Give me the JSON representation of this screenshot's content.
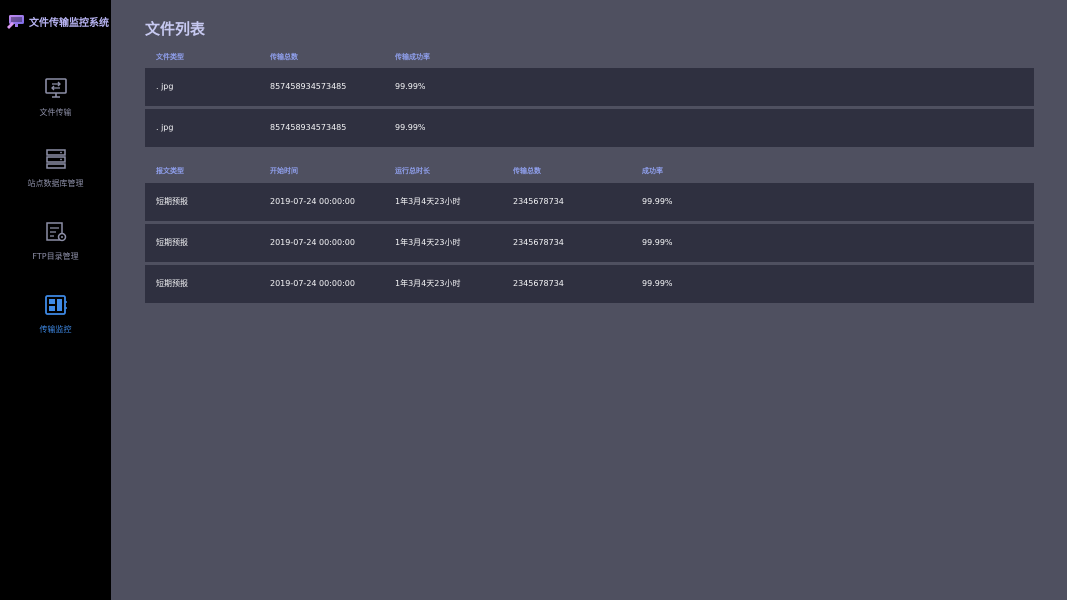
{
  "app": {
    "title": "文件传输监控系统",
    "logo_icon": "monitor-logo-icon"
  },
  "sidebar": {
    "items": [
      {
        "label": "文件传输",
        "icon": "transfer-monitor-icon",
        "active": false
      },
      {
        "label": "站点数据库管理",
        "icon": "database-icon",
        "active": false
      },
      {
        "label": "FTP目录管理",
        "icon": "ftp-directory-icon",
        "active": false
      },
      {
        "label": "传输监控",
        "icon": "dashboard-icon",
        "active": true
      }
    ]
  },
  "colors": {
    "sidebar_bg": "#000000",
    "main_bg": "#4f5060",
    "row_bg": "#2f3040",
    "header_text": "#8f9fec",
    "title_text": "#c7c9f1",
    "active_accent": "#3f8be8"
  },
  "main": {
    "title": "文件列表",
    "file_table": {
      "headers": [
        "文件类型",
        "传输总数",
        "传输成功率"
      ],
      "rows": [
        [
          ". jpg",
          "857458934573485",
          "99.99%"
        ],
        [
          ". jpg",
          "857458934573485",
          "99.99%"
        ]
      ]
    },
    "report_table": {
      "headers": [
        "报文类型",
        "开始时间",
        "运行总时长",
        "传输总数",
        "成功率"
      ],
      "rows": [
        [
          "短期预报",
          "2019-07-24 00:00:00",
          "1年3月4天23小时",
          "2345678734",
          "99.99%"
        ],
        [
          "短期预报",
          "2019-07-24 00:00:00",
          "1年3月4天23小时",
          "2345678734",
          "99.99%"
        ],
        [
          "短期预报",
          "2019-07-24 00:00:00",
          "1年3月4天23小时",
          "2345678734",
          "99.99%"
        ]
      ]
    }
  }
}
